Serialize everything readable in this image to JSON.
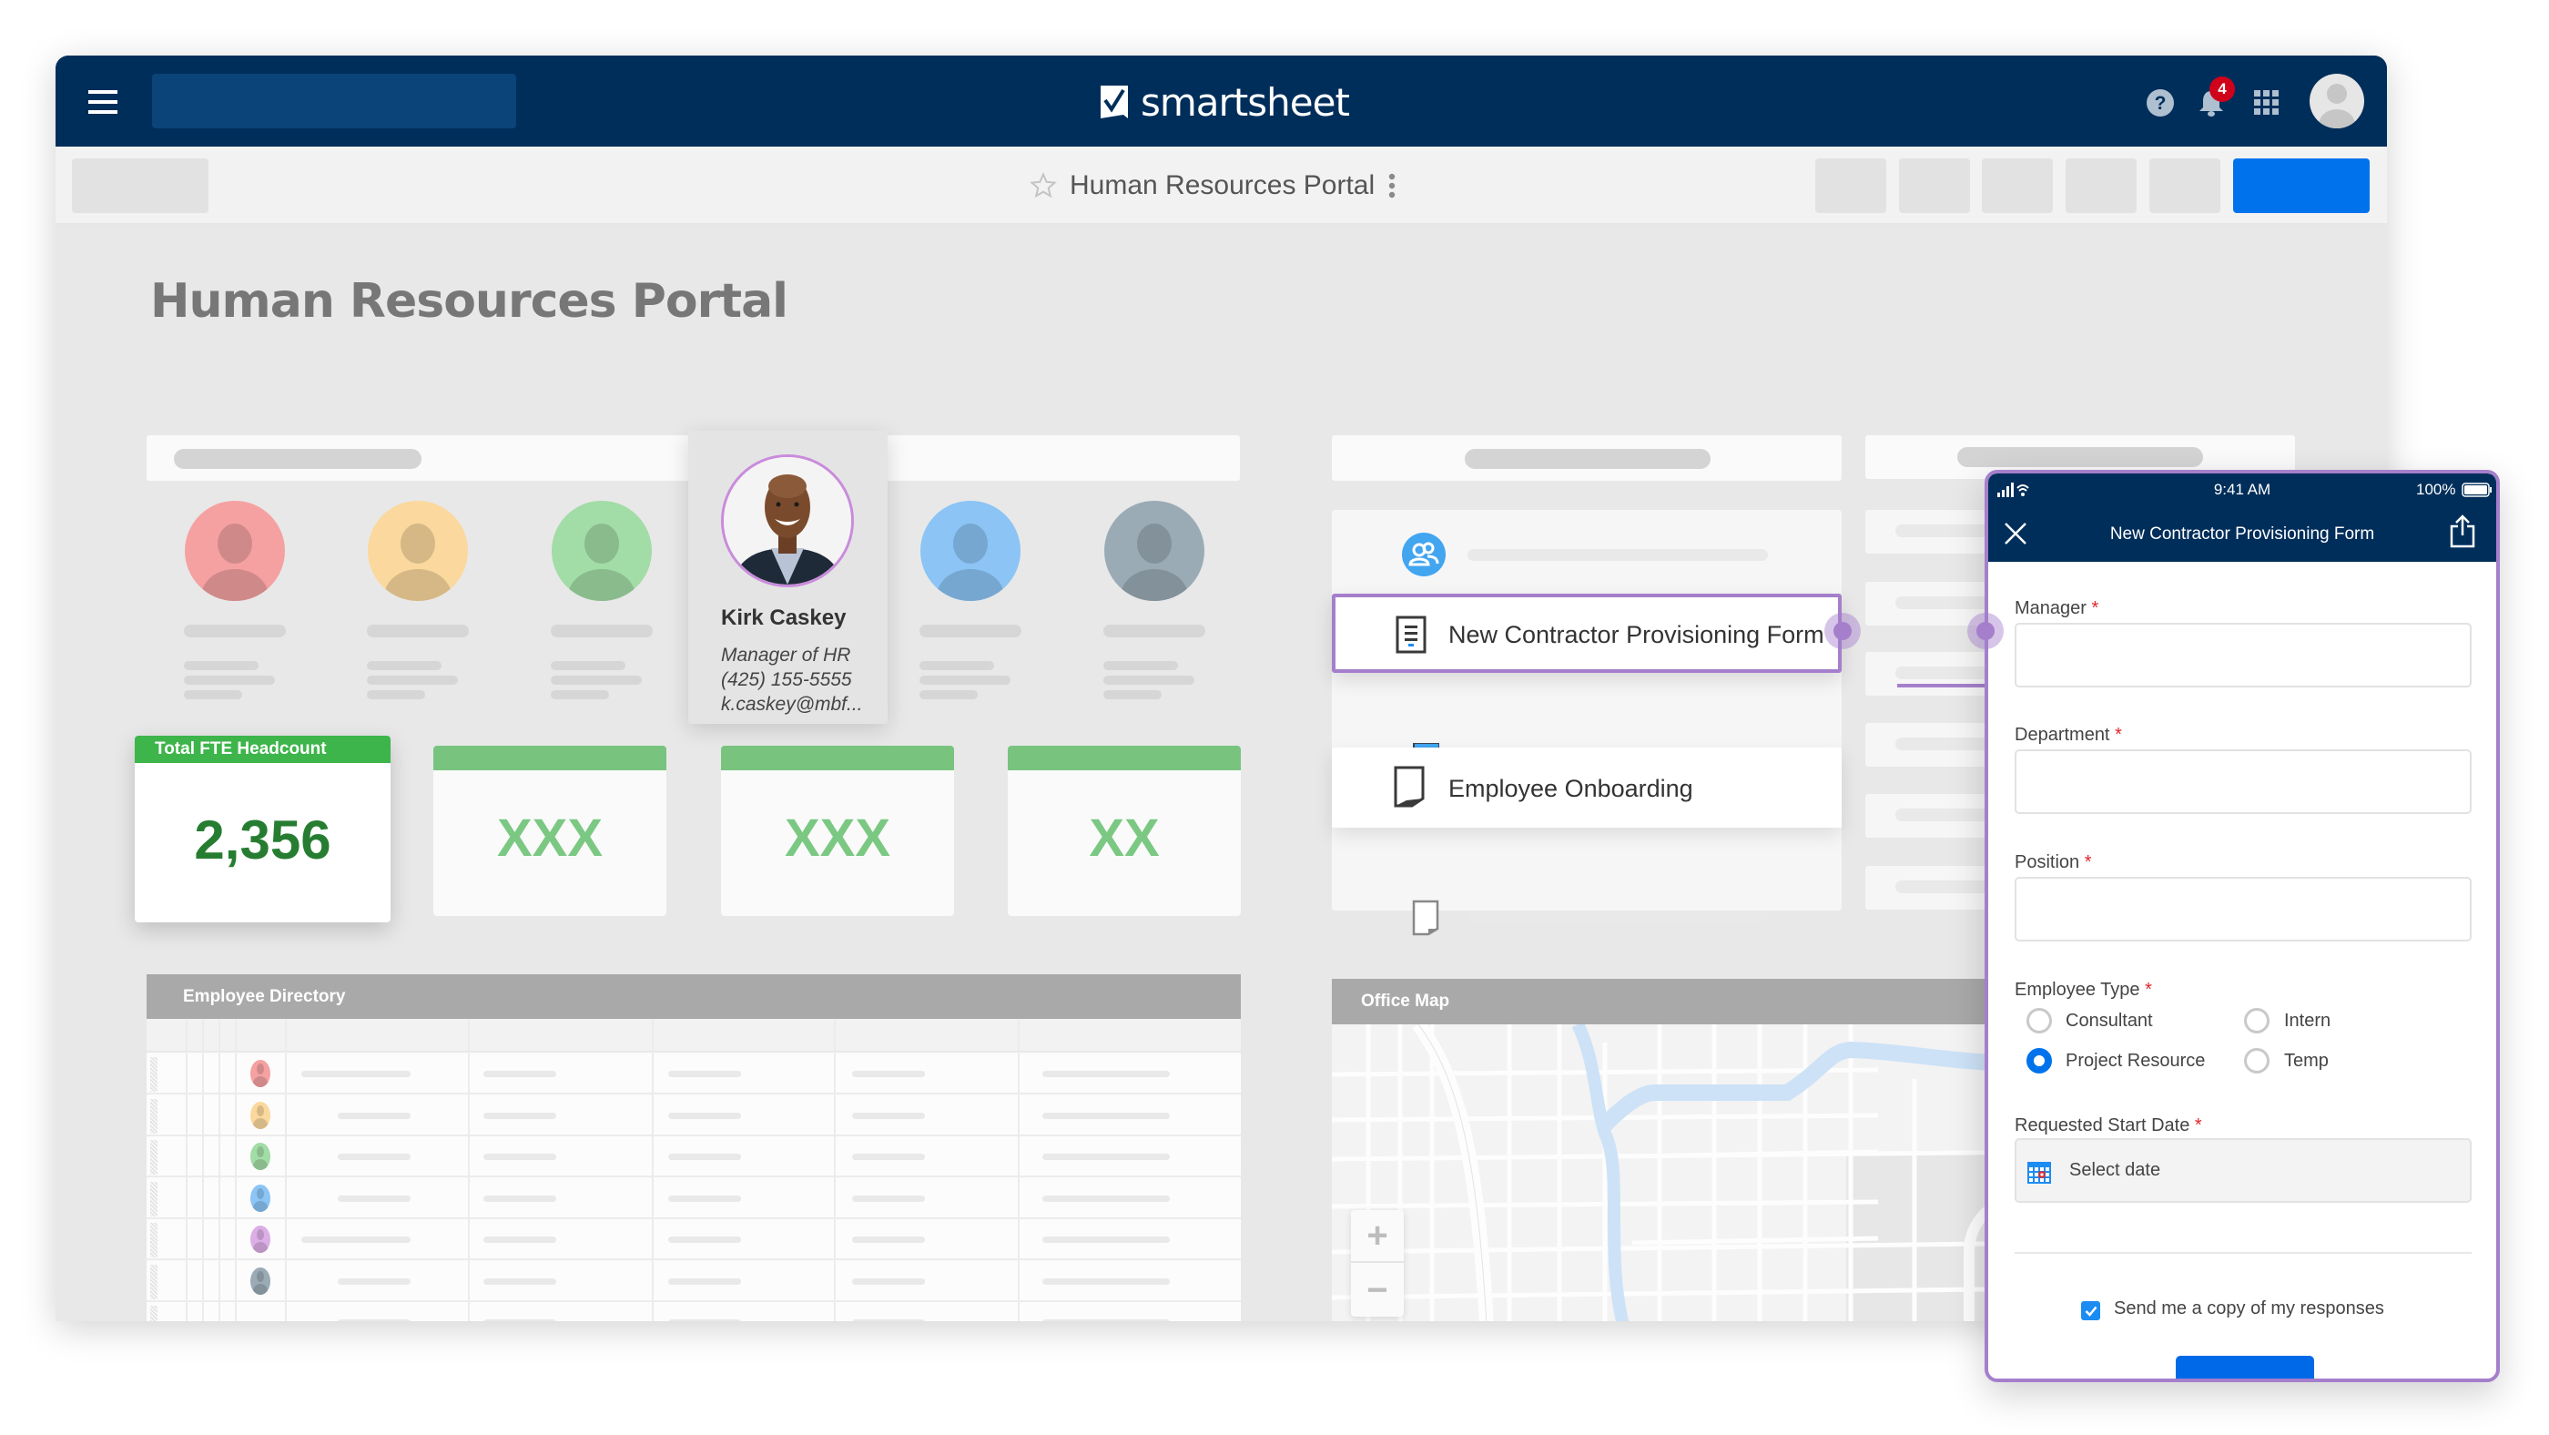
{
  "app": {
    "logo_text": "smartsheet",
    "notification_count": "4"
  },
  "toolbar": {
    "sheet_title": "Human Resources Portal"
  },
  "page": {
    "title": "Human Resources Portal"
  },
  "people": {
    "avatar_colors": [
      "#f5a1a1",
      "#fbd89d",
      "#a2dca6",
      "#8bc4f5",
      "#9aabb6"
    ],
    "featured": {
      "name": "Kirk Caskey",
      "role": "Manager of HR",
      "phone": "(425) 155-5555",
      "email": "k.caskey@mbf..."
    }
  },
  "kpis": {
    "main": {
      "label": "Total FTE Headcount",
      "value": "2,356"
    },
    "placeholders": [
      "XXX",
      "XXX",
      "XX"
    ]
  },
  "directory": {
    "title": "Employee Directory",
    "row_avatar_colors": [
      "#f5a1a1",
      "#fbd89d",
      "#a2dca6",
      "#8bc4f5",
      "#dcaee6",
      "#9aabb6"
    ]
  },
  "links": {
    "items": [
      {
        "icon": "people-icon",
        "label": ""
      },
      {
        "icon": "form-icon",
        "label": "New Contractor Provisioning Form",
        "highlighted": true
      },
      {
        "icon": "notebook-icon",
        "label": ""
      },
      {
        "icon": "sheet-icon",
        "label": "Employee Onboarding"
      },
      {
        "icon": "sheet-icon",
        "label": ""
      }
    ]
  },
  "map": {
    "title": "Office Map",
    "zoom_in": "+",
    "zoom_out": "−"
  },
  "mobile": {
    "status": {
      "time": "9:41 AM",
      "battery": "100%"
    },
    "title": "New Contractor Provisioning Form",
    "fields": {
      "manager": {
        "label": "Manager",
        "value": ""
      },
      "department": {
        "label": "Department",
        "value": ""
      },
      "position": {
        "label": "Position",
        "value": ""
      },
      "employee_type": {
        "label": "Employee Type",
        "options": [
          "Consultant",
          "Intern",
          "Project Resource",
          "Temp"
        ],
        "selected": "Project Resource"
      },
      "start_date": {
        "label": "Requested Start Date",
        "placeholder": "Select date"
      }
    },
    "required_mark": "*",
    "send_copy": {
      "label": "Send me a copy of my responses",
      "checked": true
    }
  }
}
